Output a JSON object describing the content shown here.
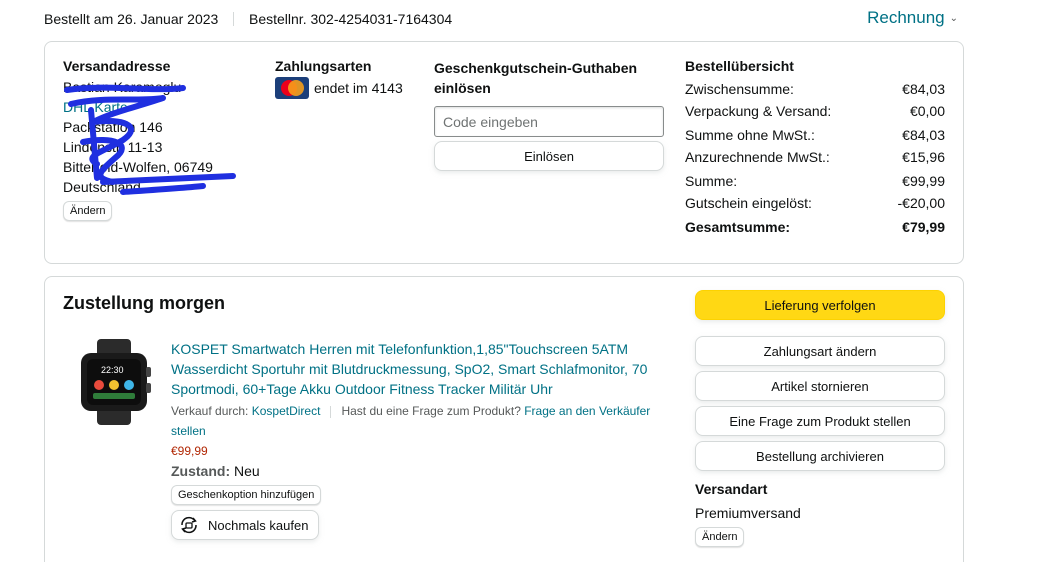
{
  "header": {
    "ordered_on": "Bestellt am 26. Januar 2023",
    "order_number": "Bestellnr. 302-4254031-7164304",
    "invoice_label": "Rechnung"
  },
  "address": {
    "heading": "Versandadresse",
    "lines": [
      "Bastian Karamoglu",
      "DHL Karte",
      "Packstation 146",
      "Lindenstr. 11-13",
      "Bitterfeld-Wolfen, 06749",
      "Deutschland"
    ],
    "change_label": "Ändern"
  },
  "payment": {
    "heading": "Zahlungsarten",
    "card_text": "endet im 4143",
    "card_icon": "mastercard-icon"
  },
  "gift": {
    "heading": "Geschenkgutschein-Guthaben einlösen",
    "placeholder": "Code eingeben",
    "redeem_label": "Einlösen"
  },
  "summary": {
    "heading": "Bestellübersicht",
    "rows": [
      {
        "label": "Zwischensumme:",
        "value": "€84,03"
      },
      {
        "label": "Verpackung & Versand:",
        "value": "€0,00"
      },
      {
        "label": "Summe ohne MwSt.:",
        "value": "€84,03"
      },
      {
        "label": "Anzurechnende MwSt.:",
        "value": "€15,96"
      },
      {
        "label": "Summe:",
        "value": "€99,99"
      },
      {
        "label": "Gutschein eingelöst:",
        "value": "-€20,00"
      }
    ],
    "total": {
      "label": "Gesamtsumme:",
      "value": "€79,99"
    }
  },
  "shipment": {
    "title": "Zustellung morgen",
    "product": {
      "title": "KOSPET Smartwatch Herren mit Telefonfunktion,1,85\"Touchscreen 5ATM Wasserdicht Sportuhr mit Blutdruckmessung, SpO2, Smart Schlafmonitor, 70 Sportmodi, 60+Tage Akku Outdoor Fitness Tracker Militär Uhr",
      "sold_by_label": "Verkauf durch:",
      "seller": "KospetDirect",
      "question_label": "Hast du eine Frage zum Produkt?",
      "question_link": "Frage an den Verkäufer stellen",
      "price": "€99,99",
      "condition_label": "Zustand:",
      "condition_value": "Neu",
      "watch_time": "22:30",
      "gift_option_label": "Geschenkoption hinzufügen",
      "rebuy_label": "Nochmals kaufen"
    },
    "actions": {
      "track": "Lieferung verfolgen",
      "change_payment": "Zahlungsart ändern",
      "cancel": "Artikel stornieren",
      "ask": "Eine Frage zum Produkt stellen",
      "archive": "Bestellung archivieren"
    },
    "shipping_method": {
      "heading": "Versandart",
      "value": "Premiumversand",
      "change_label": "Ändern"
    }
  },
  "colors": {
    "link": "#007185",
    "primary_button": "#ffd814",
    "price": "#b12704",
    "scribble": "#1f2fe0"
  }
}
